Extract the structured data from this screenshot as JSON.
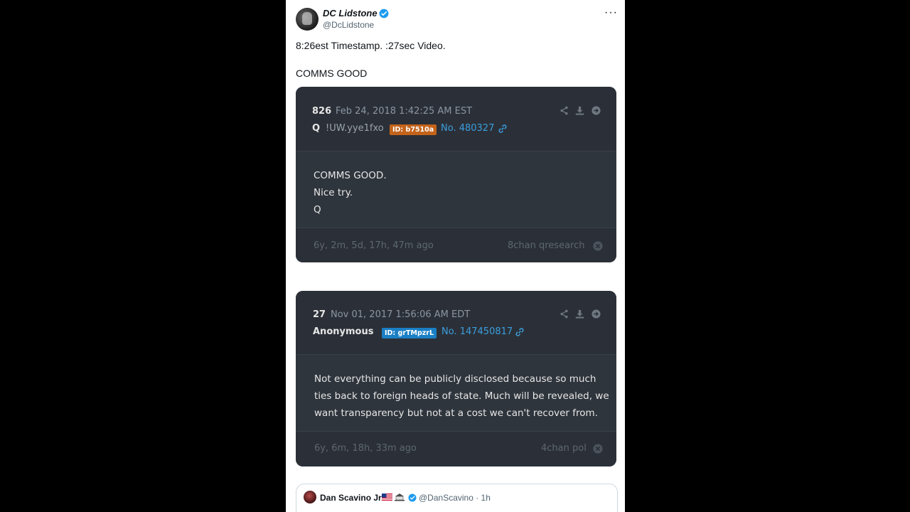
{
  "tweet": {
    "author_name": "DC Lidstone",
    "author_handle": "@DcLidstone",
    "more_label": "···",
    "line1": "8:26est Timestamp. :27sec Video.",
    "line2": "COMMS GOOD"
  },
  "cards": [
    {
      "number": "826",
      "date": "Feb 24, 2018 1:42:25 AM EST",
      "poster": "Q",
      "tripcode": "!UW.yye1fxo",
      "id_badge": "ID: b7510a",
      "id_color": "#c4631a",
      "accent_color": "#1f6fc0",
      "post_no": "No. 480327",
      "body_lines": [
        "COMMS GOOD.",
        "Nice try.",
        "Q"
      ],
      "ago": "6y, 2m, 5d, 17h, 47m ago",
      "board": "8chan qresearch"
    },
    {
      "number": "27",
      "date": "Nov 01, 2017 1:56:06 AM EDT",
      "poster": "Anonymous",
      "id_badge": "ID: grTMpzrL",
      "id_color": "#1a7fc4",
      "accent_color": "#b58a1c",
      "post_no": "No. 147450817",
      "body_lines": [
        "Not everything can be publicly disclosed because so much",
        "ties back to foreign heads of state. Much will be revealed, we",
        "want transparency but not at a cost we can't recover from."
      ],
      "ago": "6y, 6m, 18h, 33m ago",
      "board": "4chan pol"
    }
  ],
  "quoted": {
    "name": "Dan Scavino Jr.",
    "handle": "@DanScavino · 1h"
  }
}
